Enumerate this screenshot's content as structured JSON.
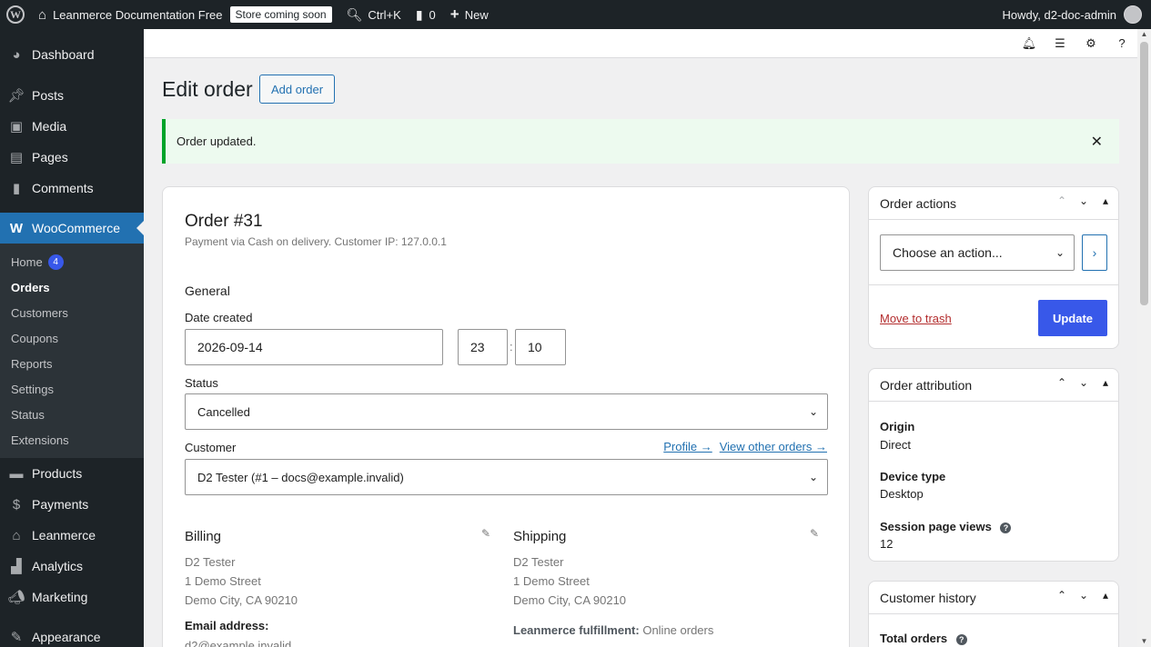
{
  "adminbar": {
    "site_name": "Leanmerce Documentation Free",
    "store_badge": "Store coming soon",
    "search_shortcut": "Ctrl+K",
    "comments_count": "0",
    "new_label": "New",
    "howdy": "Howdy, d2-doc-admin"
  },
  "sidebar": {
    "dashboard": "Dashboard",
    "posts": "Posts",
    "media": "Media",
    "pages": "Pages",
    "comments": "Comments",
    "woocommerce": "WooCommerce",
    "submenu": {
      "home": "Home",
      "home_badge": "4",
      "orders": "Orders",
      "customers": "Customers",
      "coupons": "Coupons",
      "reports": "Reports",
      "settings": "Settings",
      "status": "Status",
      "extensions": "Extensions"
    },
    "products": "Products",
    "payments": "Payments",
    "leanmerce": "Leanmerce",
    "analytics": "Analytics",
    "marketing": "Marketing",
    "appearance": "Appearance"
  },
  "header": {
    "title": "Edit order",
    "add_order": "Add order"
  },
  "notice": {
    "text": "Order updated."
  },
  "order": {
    "heading": "Order #31",
    "meta": "Payment via Cash on delivery. Customer IP: 127.0.0.1",
    "general_heading": "General",
    "date_label": "Date created",
    "date_value": "2026-09-14",
    "hour_value": "23",
    "time_sep": ":",
    "minute_value": "10",
    "status_label": "Status",
    "status_value": "Cancelled",
    "customer_label": "Customer",
    "profile_link": "Profile →",
    "other_orders_link": "View other orders →",
    "customer_value": "D2 Tester (#1 – docs@example.invalid)",
    "billing": {
      "heading": "Billing",
      "name": "D2 Tester",
      "street": "1 Demo Street",
      "city": "Demo City, CA 90210",
      "email_label": "Email address:",
      "email": "d2@example.invalid"
    },
    "shipping": {
      "heading": "Shipping",
      "name": "D2 Tester",
      "street": "1 Demo Street",
      "city": "Demo City, CA 90210",
      "fulfillment_label": "Leanmerce fulfillment:",
      "fulfillment_value": "Online orders"
    }
  },
  "order_actions": {
    "title": "Order actions",
    "select_placeholder": "Choose an action...",
    "move_to_trash": "Move to trash",
    "update": "Update"
  },
  "order_attribution": {
    "title": "Order attribution",
    "origin_label": "Origin",
    "origin_value": "Direct",
    "device_label": "Device type",
    "device_value": "Desktop",
    "session_label": "Session page views",
    "session_value": "12"
  },
  "customer_history": {
    "title": "Customer history",
    "total_orders_label": "Total orders"
  },
  "colors": {
    "admin_dark": "#1d2327",
    "accent_blue": "#2271b1",
    "woo_primary": "#3858e9",
    "success_green": "#00a32a",
    "danger_red": "#b32d2e"
  }
}
